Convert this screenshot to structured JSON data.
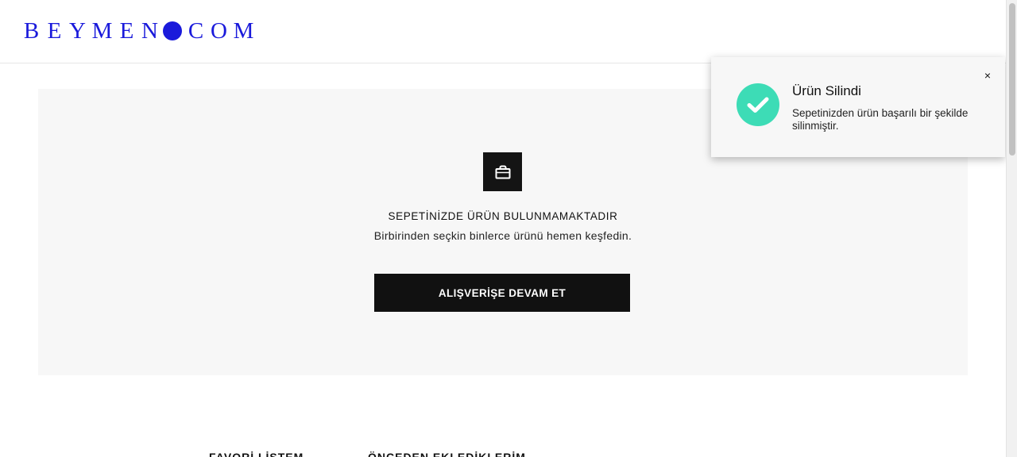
{
  "header": {
    "logo_left": "BEYMEN",
    "logo_right": "COM",
    "brand_color": "#1a1adb"
  },
  "cart": {
    "bag_icon": "shopping-bag-icon",
    "empty_title": "SEPETİNİZDE ÜRÜN BULUNMAMAKTADIR",
    "empty_subtitle": "Birbirinden seçkin binlerce ürünü hemen keşfedin.",
    "continue_label": "ALIŞVERİŞE DEVAM ET"
  },
  "bottom_links": {
    "left": "FAVORİ LİSTEM",
    "right": "ÖNCEDEN EKLEDİKLERİM"
  },
  "toast": {
    "icon": "check-circle-icon",
    "accent_color": "#3ddcb6",
    "title": "Ürün Silindi",
    "message": "Sepetinizden ürün başarılı bir şekilde silinmiştir.",
    "close_label": "×"
  }
}
